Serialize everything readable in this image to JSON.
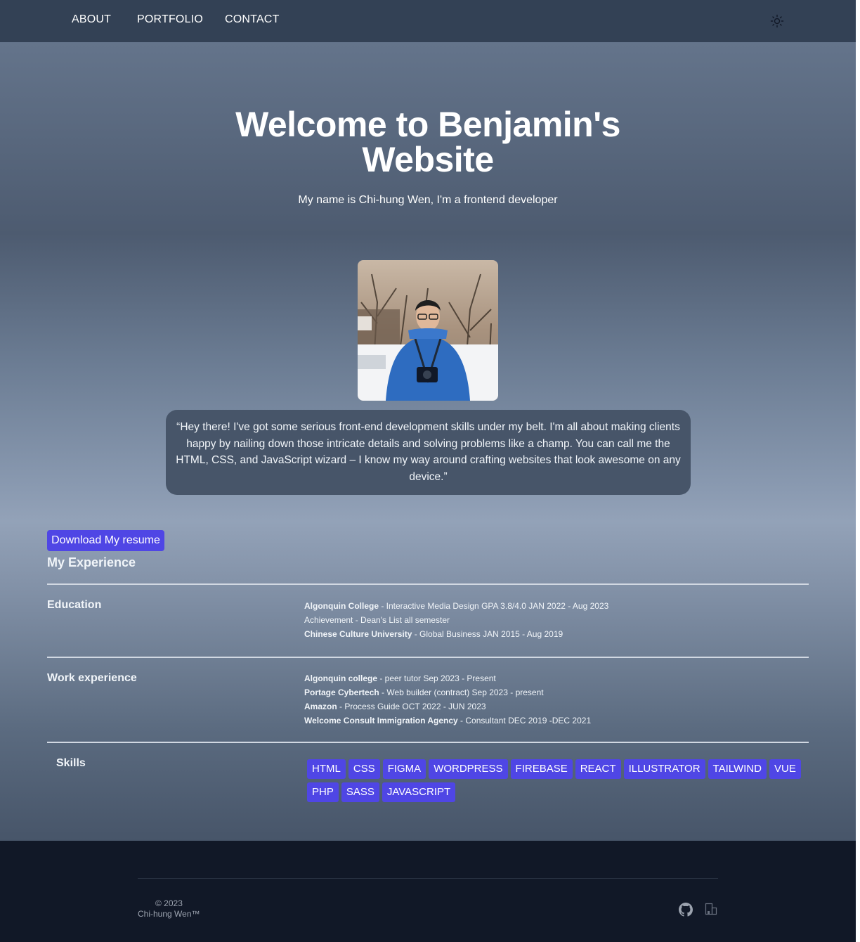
{
  "nav": {
    "about": "ABOUT",
    "portfolio": "PORTFOLIO",
    "contact": "CONTACT",
    "theme_icon": "sun-icon"
  },
  "hero": {
    "title_line1": "Welcome to Benjamin's",
    "title_line2": "Website",
    "subtitle": "My name is Chi-hung Wen, I'm a frontend developer"
  },
  "quote": "“Hey there! I've got some serious front-end development skills under my belt. I'm all about making clients happy by nailing down those intricate details and solving problems like a champ. You can call me the HTML, CSS, and JavaScript wizard – I know my way around crafting websites that look awesome on any device.”",
  "resume_button": "Download My resume",
  "experience": {
    "heading": "My Experience",
    "education": {
      "label": "Education",
      "items": [
        {
          "org": "Algonquin College",
          "detail": " - Interactive Media Design GPA 3.8/4.0 JAN 2022 - Aug 2023"
        },
        {
          "org": "",
          "detail": "Achievement - Dean's List all semester"
        },
        {
          "org": "Chinese Culture University",
          "detail": " - Global Business JAN 2015 - Aug 2019"
        }
      ]
    },
    "work": {
      "label": "Work experience",
      "items": [
        {
          "org": "Algonquin college",
          "detail": " - peer tutor Sep 2023 - Present"
        },
        {
          "org": "Portage Cybertech",
          "detail": " - Web builder (contract) Sep 2023 - present"
        },
        {
          "org": "Amazon",
          "detail": " - Process Guide OCT 2022 - JUN 2023"
        },
        {
          "org": "Welcome Consult Immigration Agency",
          "detail": " - Consultant DEC 2019 -DEC 2021"
        }
      ]
    },
    "skills": {
      "label": "Skills",
      "items": [
        "HTML",
        "CSS",
        "FIGMA",
        "WORDPRESS",
        "FIREBASE",
        "REACT",
        "ILLUSTRATOR",
        "TAILWIND",
        "VUE",
        "PHP",
        "SASS",
        "JAVASCRIPT"
      ]
    }
  },
  "footer": {
    "year": "© 2023",
    "name": "Chi-hung Wen™",
    "icons": [
      "github-icon",
      "linkedin-icon"
    ]
  },
  "colors": {
    "nav": "#334155",
    "accent": "#4f46e5",
    "footer": "#111827",
    "quote_bg": "#475569"
  }
}
